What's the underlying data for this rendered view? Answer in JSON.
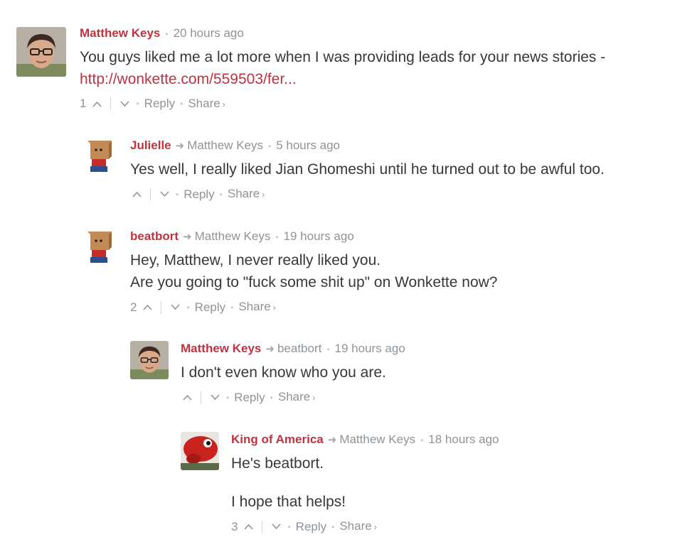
{
  "comments": [
    {
      "author": "Matthew Keys",
      "parent": "",
      "time": "20 hours ago",
      "text1": "You guys liked me a lot more when I was providing leads for your news stories -",
      "link": "http://wonkette.com/559503/fer...",
      "votes": "1",
      "reply": "Reply",
      "share": "Share",
      "avatar": "person-glasses"
    },
    {
      "author": "Julielle",
      "parent": "Matthew Keys",
      "time": "5 hours ago",
      "text1": "Yes well, I really liked Jian Ghomeshi until he turned out to be awful too.",
      "votes": "",
      "reply": "Reply",
      "share": "Share",
      "avatar": "paper-bag"
    },
    {
      "author": "beatbort",
      "parent": "Matthew Keys",
      "time": "19 hours ago",
      "text1": "Hey, Matthew, I never really liked you.",
      "text2": "Are you going to \"fuck some shit up\" on Wonkette now?",
      "votes": "2",
      "reply": "Reply",
      "share": "Share",
      "avatar": "paper-bag"
    },
    {
      "author": "Matthew Keys",
      "parent": "beatbort",
      "time": "19 hours ago",
      "text1": "I don't even know who you are.",
      "votes": "",
      "reply": "Reply",
      "share": "Share",
      "avatar": "person-glasses"
    },
    {
      "author": "King of America",
      "parent": "Matthew Keys",
      "time": "18 hours ago",
      "text1": "He's beatbort.",
      "text2": "I hope that helps!",
      "votes": "3",
      "reply": "Reply",
      "share": "Share",
      "avatar": "red-creature"
    }
  ]
}
